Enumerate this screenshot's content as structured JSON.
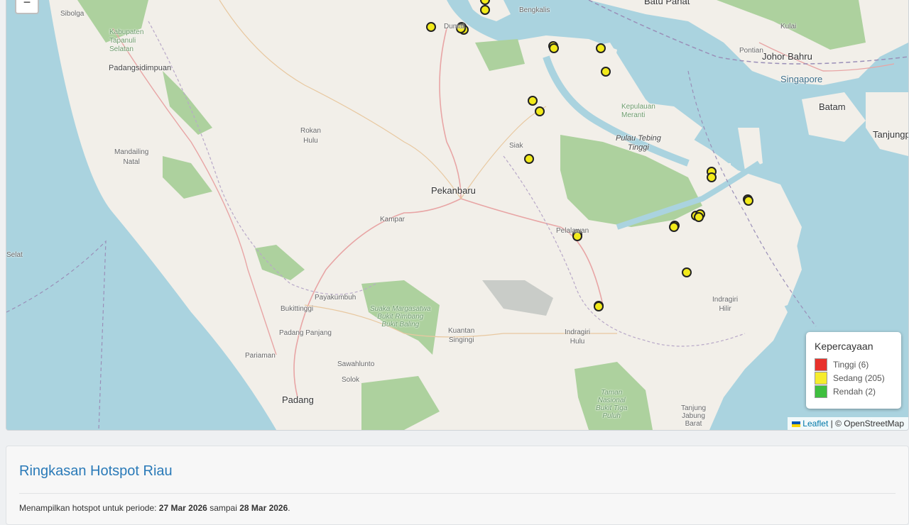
{
  "map": {
    "zoom_out_label": "−",
    "places": {
      "sibolga": "Sibolga",
      "kab_tapanuli": "Kabupaten\nTapanuli\nSelatan",
      "padangsidimpuan": "Padangsidimpuan",
      "mandailing": "Mandailing\nNatal",
      "rokan_hulu": "Rokan\nHulu",
      "dumai": "Dumai",
      "bengkalis": "Bengkalis",
      "siak": "Siak",
      "pekanbaru": "Pekanbaru",
      "kampar": "Kampar",
      "kepulauan_meranti": "Kepulauan\nMeranti",
      "pulau_tebing_tinggi": "Pulau Tebing\nTinggi",
      "batu_pahat": "Batu Pahat",
      "kulai": "Kulai",
      "pontian": "Pontian",
      "johor_bahru": "Johor Bahru",
      "singapore": "Singapore",
      "batam": "Batam",
      "tanjungpinang": "Tanjungpin",
      "pelalawan": "Pelalawan",
      "payakumbuh": "Payakumbuh",
      "suaka": "Suaka Margasatwa\nBukit Rimbang\nBukit Baling",
      "bukittinggi": "Bukittinggi",
      "padang_panjang": "Padang Panjang",
      "pariaman": "Pariaman",
      "sawahlunto": "Sawahlunto",
      "solok": "Solok",
      "padang": "Padang",
      "kuantan": "Kuantan\nSingingi",
      "indragiri_hulu": "Indragiri\nHulu",
      "indragiri_hilir": "Indragiri\nHilir",
      "taman_nasional": "Taman\nNasional\nBukit Tiga\nPuluh",
      "tanjung_jabung": "Tanjung\nJabung\nBarat",
      "selat": "Selat"
    },
    "legend": {
      "title": "Kepercayaan",
      "items": [
        {
          "label": "Tinggi (6)",
          "color": "#e8312b"
        },
        {
          "label": "Sedang (205)",
          "color": "#f6ec2d"
        },
        {
          "label": "Rendah (2)",
          "color": "#3fbf3f"
        }
      ]
    },
    "attribution": {
      "leaflet": "Leaflet",
      "separator": " | © ",
      "osm": "OpenStreetMap"
    },
    "hotspot_color": "#f2ea1a",
    "hotspot_count_shown": 30
  },
  "summary": {
    "title": "Ringkasan Hotspot Riau",
    "period_prefix": "Menampilkan hotspot untuk periode: ",
    "start_date": "27 Mar 2026",
    "connector": " sampai ",
    "end_date": "28 Mar 2026",
    "period_suffix": "."
  }
}
